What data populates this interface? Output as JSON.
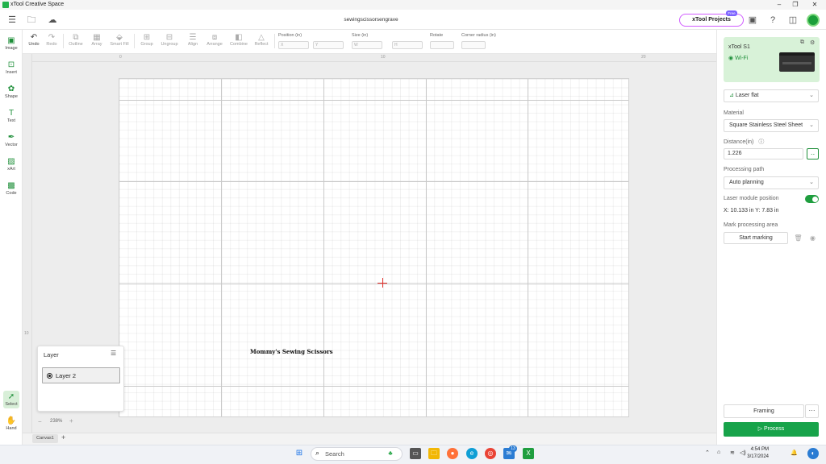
{
  "app": {
    "title": "xTool Creative Space",
    "filename": "sewingscissorsengrave"
  },
  "header": {
    "projects_label": "xTool Projects",
    "free_badge": "Free"
  },
  "toolbar": {
    "undo": "Undo",
    "redo": "Redo",
    "outline": "Outline",
    "array": "Array",
    "smart_fill": "Smart Fill",
    "group": "Group",
    "ungroup": "Ungroup",
    "align": "Align",
    "arrange": "Arrange",
    "combine": "Combine",
    "reflect": "Reflect",
    "position_label": "Position (in)",
    "x_placeholder": "X",
    "y_placeholder": "Y",
    "size_label": "Size (in)",
    "w_placeholder": "W",
    "h_placeholder": "H",
    "rotate_label": "Rotate",
    "corner_label": "Corner radius (in)"
  },
  "left_tools": {
    "image": "Image",
    "insert": "Insert",
    "shape": "Shape",
    "text": "Text",
    "vector": "Vector",
    "xart": "xArt",
    "code": "Code",
    "select": "Select",
    "hand": "Hand"
  },
  "ruler": {
    "tick_0": "0",
    "tick_10": "10",
    "tick_20": "20",
    "left_10": "10"
  },
  "canvas": {
    "design_text": "Mommy's Sewing Scissors",
    "zoom": "238%",
    "tab": "Canvas1"
  },
  "layers": {
    "title": "Layer",
    "items": [
      {
        "label": "Layer 2"
      }
    ]
  },
  "right_panel": {
    "device_name": "xTool S1",
    "device_connection": "Wi-Fi",
    "mode": "Laser flat",
    "material_label": "Material",
    "material_value": "Square Stainless Steel Sheet",
    "distance_label": "Distance(in)",
    "distance_value": "1.226",
    "processing_path_label": "Processing path",
    "processing_path_value": "Auto planning",
    "module_position_label": "Laser module position",
    "module_position_on": true,
    "coords": "X: 10.133 in   Y: 7.83 in",
    "mark_area_label": "Mark processing area",
    "start_marking": "Start marking",
    "framing": "Framing",
    "more": "···",
    "process": "Process"
  },
  "taskbar": {
    "search": "Search",
    "badge": "13",
    "time": "4:54 PM",
    "date": "3/17/2024"
  },
  "colors": {
    "accent": "#17a34a",
    "crosshair": "#e5322d",
    "device_card": "#d8f2d8"
  }
}
